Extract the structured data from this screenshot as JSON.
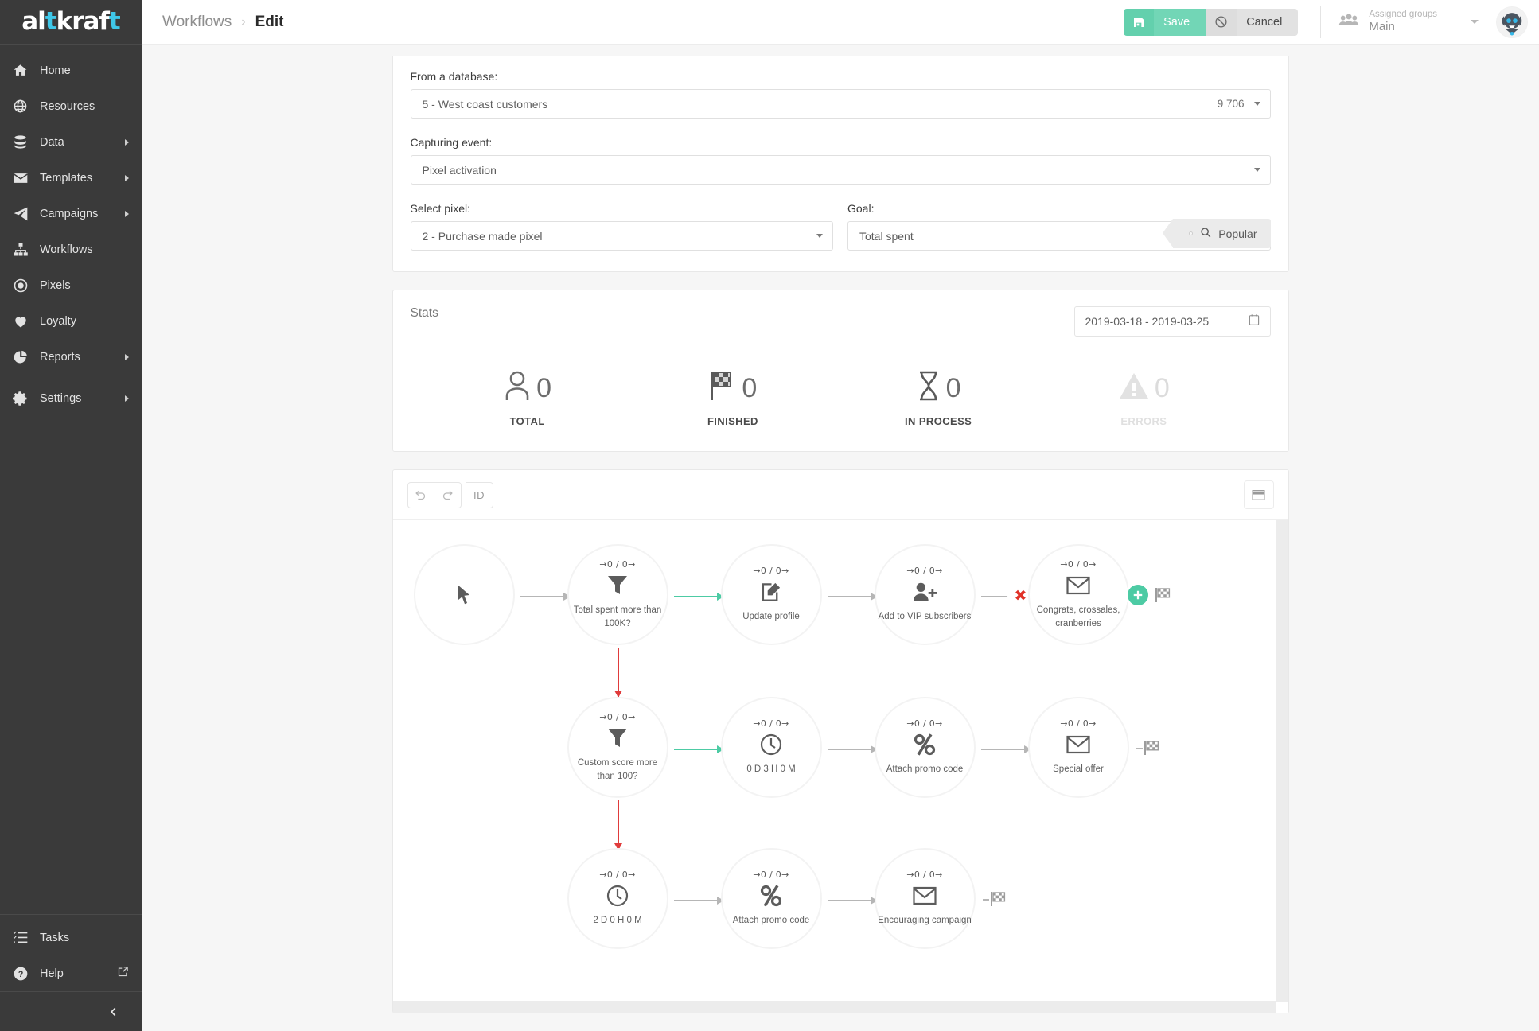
{
  "brand": {
    "text_a": "al",
    "text_b": "t",
    "text_c": "kraf",
    "text_d": "t"
  },
  "sidebar": {
    "items": [
      {
        "label": "Home",
        "icon": "home-icon",
        "caret": false
      },
      {
        "label": "Resources",
        "icon": "globe-icon",
        "caret": false
      },
      {
        "label": "Data",
        "icon": "database-icon",
        "caret": true
      },
      {
        "label": "Templates",
        "icon": "envelope-icon",
        "caret": true
      },
      {
        "label": "Campaigns",
        "icon": "paper-plane-icon",
        "caret": true
      },
      {
        "label": "Workflows",
        "icon": "sitemap-icon",
        "caret": false
      },
      {
        "label": "Pixels",
        "icon": "target-icon",
        "caret": false
      },
      {
        "label": "Loyalty",
        "icon": "heart-icon",
        "caret": false
      },
      {
        "label": "Reports",
        "icon": "pie-chart-icon",
        "caret": true
      },
      {
        "label": "Settings",
        "icon": "gear-icon",
        "caret": true
      }
    ],
    "bottom": [
      {
        "label": "Tasks",
        "icon": "tasks-icon"
      },
      {
        "label": "Help",
        "icon": "question-circle-icon"
      }
    ]
  },
  "topbar": {
    "breadcrumb_parent": "Workflows",
    "breadcrumb_sep": "›",
    "breadcrumb_current": "Edit",
    "save_label": "Save",
    "cancel_label": "Cancel",
    "groups_label": "Assigned groups",
    "groups_value": "Main"
  },
  "form": {
    "database_label": "From a database:",
    "database_value": "5 - West coast customers",
    "database_count": "9 706",
    "event_label": "Capturing event:",
    "event_value": "Pixel activation",
    "pixel_label": "Select pixel:",
    "pixel_value": "2 - Purchase made pixel",
    "goal_label": "Goal:",
    "goal_value": "Total spent",
    "goal_placeholder": "Total spent",
    "popular_label": "Popular"
  },
  "stats": {
    "title": "Stats",
    "date_range": "2019-03-18 - 2019-03-25",
    "items": [
      {
        "value": "0",
        "label": "TOTAL",
        "icon": "user-icon",
        "dim": false
      },
      {
        "value": "0",
        "label": "FINISHED",
        "icon": "checkered-flag-icon",
        "dim": false
      },
      {
        "value": "0",
        "label": "IN PROCESS",
        "icon": "hourglass-icon",
        "dim": false
      },
      {
        "value": "0",
        "label": "ERRORS",
        "icon": "warning-triangle-icon",
        "dim": true
      }
    ]
  },
  "workflow": {
    "toolbar": {
      "undo": "undo-icon",
      "redo": "redo-icon",
      "id_label": "ID",
      "window_label": "window-icon"
    },
    "nodes": [
      {
        "id": "start",
        "counter": "",
        "title": "",
        "icon": "cursor-icon"
      },
      {
        "id": "filter1",
        "counter": "→0 / 0→",
        "title": "Total spent more than 100K?",
        "icon": "funnel-icon"
      },
      {
        "id": "update",
        "counter": "→0 / 0→",
        "title": "Update profile",
        "icon": "edit-icon"
      },
      {
        "id": "vip",
        "counter": "→0 / 0→",
        "title": "Add to VIP subscribers",
        "icon": "user-plus-icon"
      },
      {
        "id": "email1",
        "counter": "→0 / 0→",
        "title": "Congrats, crossales, cranberries",
        "icon": "envelope-icon"
      },
      {
        "id": "filter2",
        "counter": "→0 / 0→",
        "title": "Custom score more than 100?",
        "icon": "funnel-icon"
      },
      {
        "id": "delay1",
        "counter": "→0 / 0→",
        "title": "0 D 3 H 0 M",
        "icon": "clock-icon"
      },
      {
        "id": "promo1",
        "counter": "→0 / 0→",
        "title": "Attach promo code",
        "icon": "percent-icon"
      },
      {
        "id": "email2",
        "counter": "→0 / 0→",
        "title": "Special offer",
        "icon": "envelope-icon"
      },
      {
        "id": "delay2",
        "counter": "→0 / 0→",
        "title": "2 D 0 H 0 M",
        "icon": "clock-icon"
      },
      {
        "id": "promo2",
        "counter": "→0 / 0→",
        "title": "Attach promo code",
        "icon": "percent-icon"
      },
      {
        "id": "email3",
        "counter": "→0 / 0→",
        "title": "Encouraging campaign",
        "icon": "envelope-icon"
      }
    ],
    "badges": {
      "error_mark": "✖",
      "add_node": "add-node-icon"
    }
  },
  "colors": {
    "accent_green": "#63d0ad",
    "brand_cyan": "#3fc7e8",
    "sidebar_bg": "#3a3a3a",
    "error_red": "#e03127",
    "link_green": "#4dcba4"
  }
}
